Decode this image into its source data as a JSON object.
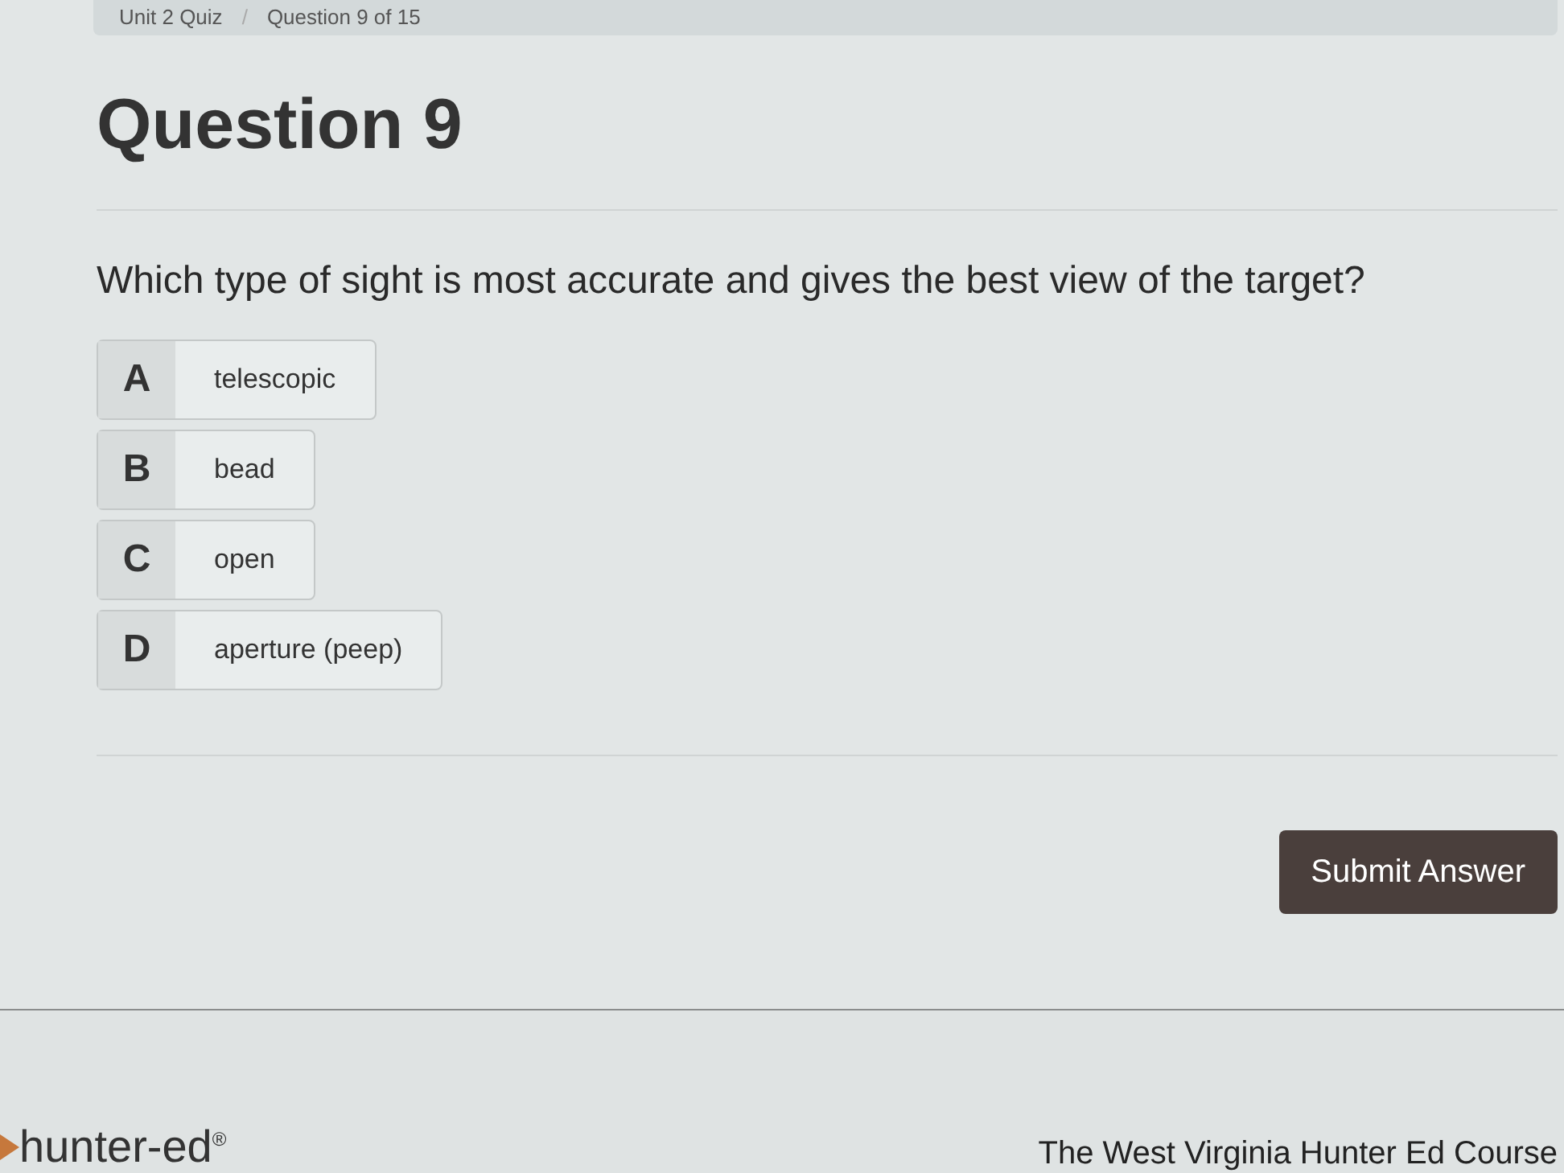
{
  "breadcrumb": [
    "Unit 2 Quiz",
    "Question 9 of 15"
  ],
  "breadcrumb_separator": "/",
  "title": "Question 9",
  "question": "Which type of sight is most accurate and gives the best view of the target?",
  "options": [
    {
      "letter": "A",
      "text": "telescopic"
    },
    {
      "letter": "B",
      "text": "bead"
    },
    {
      "letter": "C",
      "text": "open"
    },
    {
      "letter": "D",
      "text": "aperture (peep)"
    }
  ],
  "submit_button": "Submit Answer",
  "footer": {
    "logo": "hunter-ed",
    "logo_mark": "®",
    "course": "The West Virginia Hunter Ed Course"
  }
}
